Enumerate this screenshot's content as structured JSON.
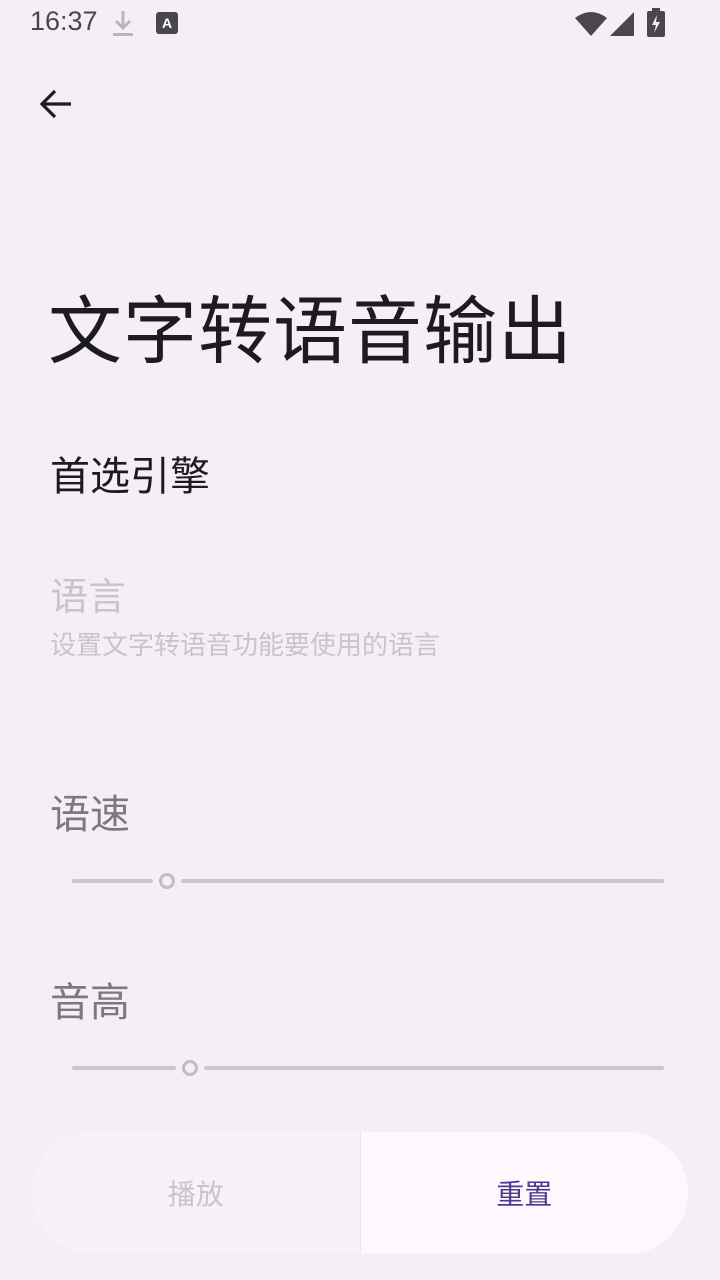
{
  "status_bar": {
    "time": "16:37",
    "icons": [
      "download-icon",
      "a-notification-icon",
      "wifi-icon",
      "signal-icon",
      "battery-charging-icon"
    ],
    "a_icon_letter": "A"
  },
  "toolbar": {
    "back_icon": "arrow-left-icon"
  },
  "page": {
    "title": "文字转语音输出"
  },
  "prefs": {
    "engine_title": "首选引擎",
    "language_title": "语言",
    "language_summary": "设置文字转语音功能要使用的语言",
    "rate_title": "语速",
    "rate_value": 0.16,
    "pitch_title": "音高",
    "pitch_value": 0.2
  },
  "actions": {
    "play_label": "播放",
    "reset_label": "重置"
  },
  "colors": {
    "background": "#f4eff6",
    "accent": "#4f378b",
    "disabled_text": "#c8c3cd"
  }
}
